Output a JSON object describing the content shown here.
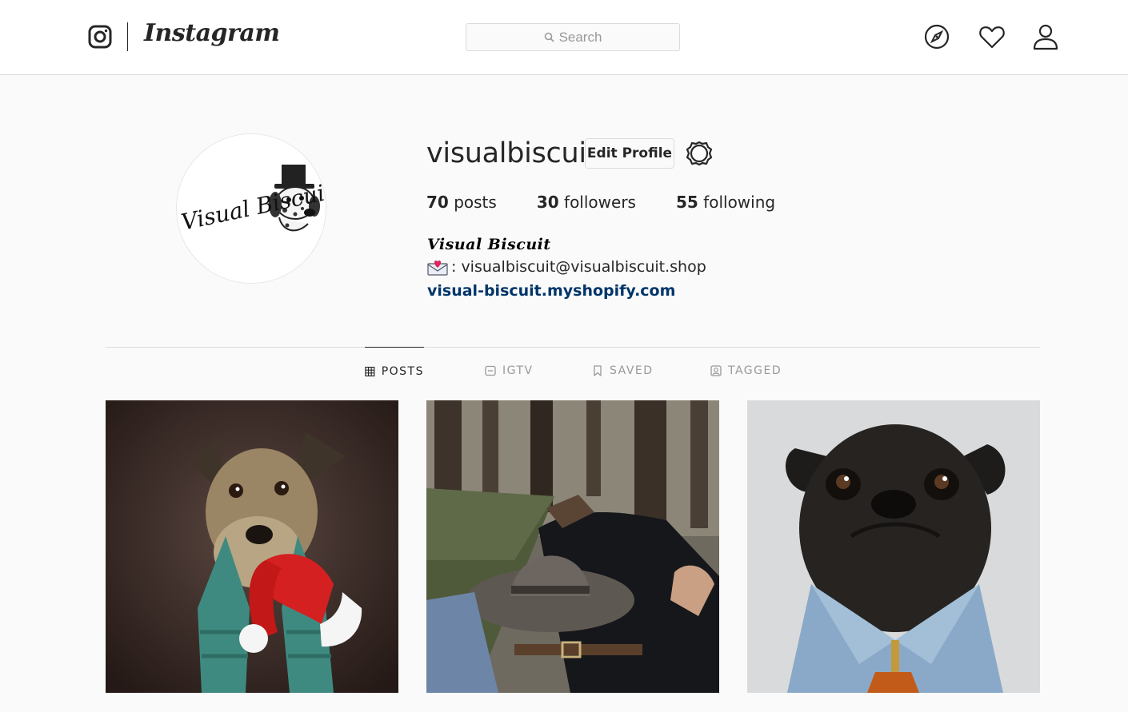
{
  "nav": {
    "brand": "Instagram",
    "search_placeholder": "Search",
    "icons": [
      "instagram-glyph-icon",
      "explore-compass-icon",
      "activity-heart-icon",
      "profile-person-icon"
    ]
  },
  "profile": {
    "username": "visualbiscuit",
    "edit_label": "Edit Profile",
    "stats": {
      "posts_count": "70",
      "posts_label": "posts",
      "followers_count": "30",
      "followers_label": "followers",
      "following_count": "55",
      "following_label": "following"
    },
    "bio_name": "Visual Biscuit",
    "bio_email": ": visualbiscuit@visualbiscuit.shop",
    "bio_link": "visual-biscuit.myshopify.com",
    "avatar_logo_text": "Visual Biscuit"
  },
  "tabs": [
    {
      "label": "POSTS",
      "icon": "grid-icon",
      "active": true
    },
    {
      "label": "IGTV",
      "icon": "igtv-icon",
      "active": false
    },
    {
      "label": "SAVED",
      "icon": "bookmark-icon",
      "active": false
    },
    {
      "label": "TAGGED",
      "icon": "tag-user-icon",
      "active": false
    }
  ],
  "posts": [
    {
      "subject": "dog with scarf and santa hat"
    },
    {
      "subject": "person in hammock with hat"
    },
    {
      "subject": "pug in denim jacket"
    }
  ],
  "colors": {
    "background": "#fafafa",
    "link": "#003569",
    "muted": "#999999",
    "border": "#dbdbdb"
  }
}
